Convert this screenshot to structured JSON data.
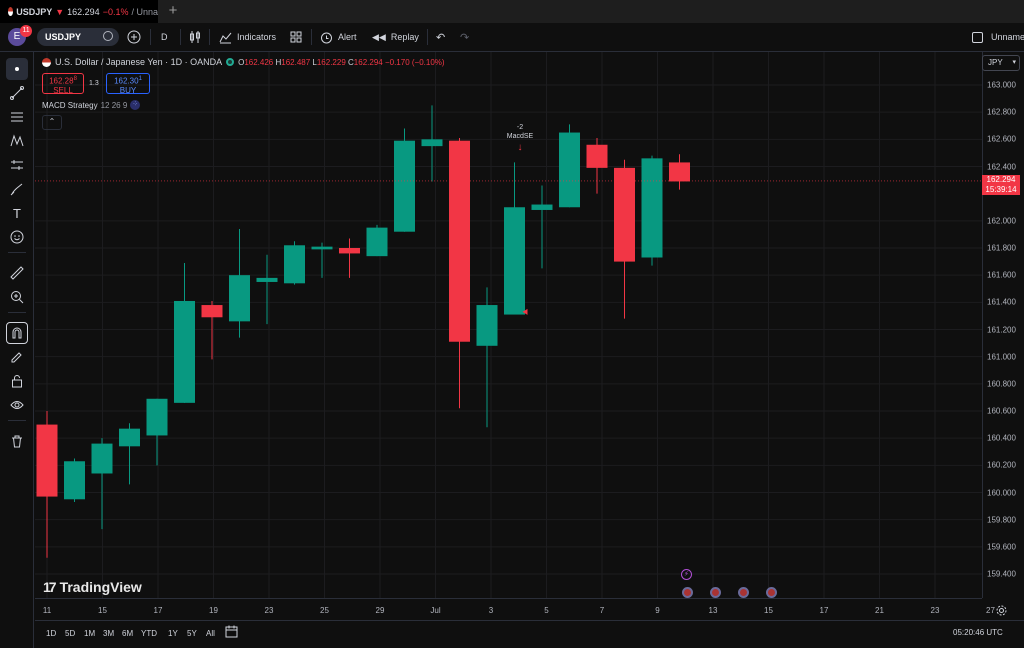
{
  "browser_tab": {
    "symbol": "USDJPY",
    "arrow": "▼",
    "price": "162.294",
    "change": "−0.1%",
    "suffix": "/ Unna",
    "new_tab_icon": "plus-icon"
  },
  "toolbar": {
    "avatar_letter": "E",
    "notification_count": "11",
    "symbol": "USDJPY",
    "interval": "D",
    "indicators_label": "Indicators",
    "alert_label": "Alert",
    "replay_label": "Replay",
    "layout_name": "Unname"
  },
  "legend": {
    "title": "U.S. Dollar / Japanese Yen · 1D · OANDA",
    "open_label": "O",
    "open": "162.426",
    "high_label": "H",
    "high": "162.487",
    "low_label": "L",
    "low": "162.229",
    "close_label": "C",
    "close": "162.294",
    "change": "−0.170 (−0.10%)",
    "sell_price": "162.28",
    "sell_sup": "8",
    "sell_label": "SELL",
    "spread": "1.3",
    "buy_price": "162.30",
    "buy_sup": "1",
    "buy_label": "BUY",
    "strategy_name": "MACD Strategy",
    "strategy_params": "12 26 9",
    "collapse_icon": "chevron-up-icon"
  },
  "signal": {
    "qty": "-2",
    "name": "MacdSE"
  },
  "price_scale": {
    "currency": "JPY",
    "labels": [
      "163.000",
      "162.800",
      "162.600",
      "162.400",
      "162.000",
      "161.800",
      "161.600",
      "161.400",
      "161.200",
      "161.000",
      "160.800",
      "160.600",
      "160.400",
      "160.200",
      "160.000",
      "159.800",
      "159.600",
      "159.400"
    ],
    "last_price": "162.294",
    "countdown": "15:39:14"
  },
  "time_axis": {
    "labels": [
      "11",
      "15",
      "17",
      "19",
      "23",
      "25",
      "29",
      "Jul",
      "3",
      "5",
      "7",
      "9",
      "13",
      "15",
      "17",
      "21",
      "23",
      "27"
    ]
  },
  "bottom_bar": {
    "ranges": [
      "1D",
      "5D",
      "1M",
      "3M",
      "6M",
      "YTD",
      "1Y",
      "5Y",
      "All"
    ],
    "clock": "05:20:46 UTC"
  },
  "branding": {
    "logo_text": "TradingView"
  },
  "colors": {
    "up": "#089981",
    "down": "#f23645",
    "accent": "#2962ff",
    "background": "#0f0f0f"
  },
  "chart_data": {
    "type": "candlestick",
    "symbol": "USDJPY",
    "interval": "1D",
    "ylim": [
      159.3,
      163.2
    ],
    "candles": [
      {
        "o": 160.5,
        "h": 160.6,
        "l": 159.52,
        "c": 159.97
      },
      {
        "o": 159.95,
        "h": 160.25,
        "l": 159.93,
        "c": 160.23
      },
      {
        "o": 160.14,
        "h": 160.4,
        "l": 159.73,
        "c": 160.36
      },
      {
        "o": 160.34,
        "h": 160.51,
        "l": 160.06,
        "c": 160.47
      },
      {
        "o": 160.42,
        "h": 160.69,
        "l": 160.2,
        "c": 160.69
      },
      {
        "o": 160.66,
        "h": 161.69,
        "l": 160.66,
        "c": 161.41
      },
      {
        "o": 161.38,
        "h": 161.41,
        "l": 160.98,
        "c": 161.29
      },
      {
        "o": 161.26,
        "h": 161.94,
        "l": 161.14,
        "c": 161.6
      },
      {
        "o": 161.55,
        "h": 161.75,
        "l": 161.24,
        "c": 161.58
      },
      {
        "o": 161.54,
        "h": 161.85,
        "l": 161.53,
        "c": 161.82
      },
      {
        "o": 161.79,
        "h": 161.84,
        "l": 161.58,
        "c": 161.81
      },
      {
        "o": 161.8,
        "h": 161.87,
        "l": 161.58,
        "c": 161.76
      },
      {
        "o": 161.74,
        "h": 161.97,
        "l": 161.74,
        "c": 161.95
      },
      {
        "o": 161.92,
        "h": 162.68,
        "l": 161.92,
        "c": 162.59
      },
      {
        "o": 162.55,
        "h": 162.85,
        "l": 162.29,
        "c": 162.6
      },
      {
        "o": 162.59,
        "h": 162.61,
        "l": 160.62,
        "c": 161.11
      },
      {
        "o": 161.08,
        "h": 161.51,
        "l": 160.48,
        "c": 161.38
      },
      {
        "o": 161.31,
        "h": 162.43,
        "l": 161.31,
        "c": 162.1
      },
      {
        "o": 162.08,
        "h": 162.26,
        "l": 161.65,
        "c": 162.12
      },
      {
        "o": 162.1,
        "h": 162.71,
        "l": 162.1,
        "c": 162.65
      },
      {
        "o": 162.56,
        "h": 162.61,
        "l": 162.2,
        "c": 162.39
      },
      {
        "o": 162.39,
        "h": 162.45,
        "l": 161.28,
        "c": 161.7
      },
      {
        "o": 161.73,
        "h": 162.48,
        "l": 161.67,
        "c": 162.46
      },
      {
        "o": 162.43,
        "h": 162.49,
        "l": 162.23,
        "c": 162.29
      }
    ]
  }
}
